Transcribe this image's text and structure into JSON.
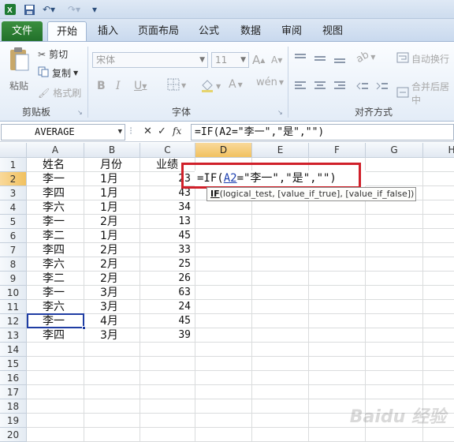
{
  "ribbon_tabs": [
    "文件",
    "开始",
    "插入",
    "页面布局",
    "公式",
    "数据",
    "审阅",
    "视图"
  ],
  "clipboard": {
    "paste": "粘贴",
    "cut": "剪切",
    "copy": "复制",
    "format_painter": "格式刷",
    "group_label": "剪贴板"
  },
  "font": {
    "name": "宋体",
    "size": "11",
    "group_label": "字体",
    "bold": "B",
    "italic": "I",
    "underline": "U",
    "grow": "A",
    "shrink": "A"
  },
  "alignment": {
    "wrap_text": "自动换行",
    "merge_center": "合并后居中",
    "group_label": "对齐方式"
  },
  "name_box": "AVERAGE",
  "formula_bar": {
    "cancel": "✕",
    "enter": "✓",
    "fx": "fx",
    "value": "=IF(A2=\"李一\",\"是\",\"\")"
  },
  "columns": [
    "A",
    "B",
    "C",
    "D",
    "E",
    "F",
    "G",
    "H"
  ],
  "rows": [
    "1",
    "2",
    "3",
    "4",
    "5",
    "6",
    "7",
    "8",
    "9",
    "10",
    "11",
    "12",
    "13",
    "14",
    "15",
    "16",
    "17",
    "18",
    "19",
    "20"
  ],
  "headers": [
    "姓名",
    "月份",
    "业绩"
  ],
  "table": [
    [
      "李一",
      "1月",
      "23"
    ],
    [
      "李四",
      "1月",
      "43"
    ],
    [
      "李六",
      "1月",
      "34"
    ],
    [
      "李一",
      "2月",
      "13"
    ],
    [
      "李二",
      "1月",
      "45"
    ],
    [
      "李四",
      "2月",
      "33"
    ],
    [
      "李六",
      "2月",
      "25"
    ],
    [
      "李二",
      "2月",
      "26"
    ],
    [
      "李一",
      "3月",
      "63"
    ],
    [
      "李六",
      "3月",
      "24"
    ],
    [
      "李一",
      "4月",
      "45"
    ],
    [
      "李四",
      "3月",
      "39"
    ]
  ],
  "editing": {
    "fn": "=IF(",
    "ref": "A2",
    "rest": "=\"李一\",\"是\",\"\")"
  },
  "tooltip": {
    "fn": "IF",
    "args": "(logical_test, [value_if_true], [value_if_false])"
  },
  "watermark": "Baidu 经验",
  "colors": {
    "active_border": "#1f3da3",
    "highlight_box": "#d0202a",
    "selected_header": "#f1c15f",
    "file_tab": "#2a7a30"
  }
}
